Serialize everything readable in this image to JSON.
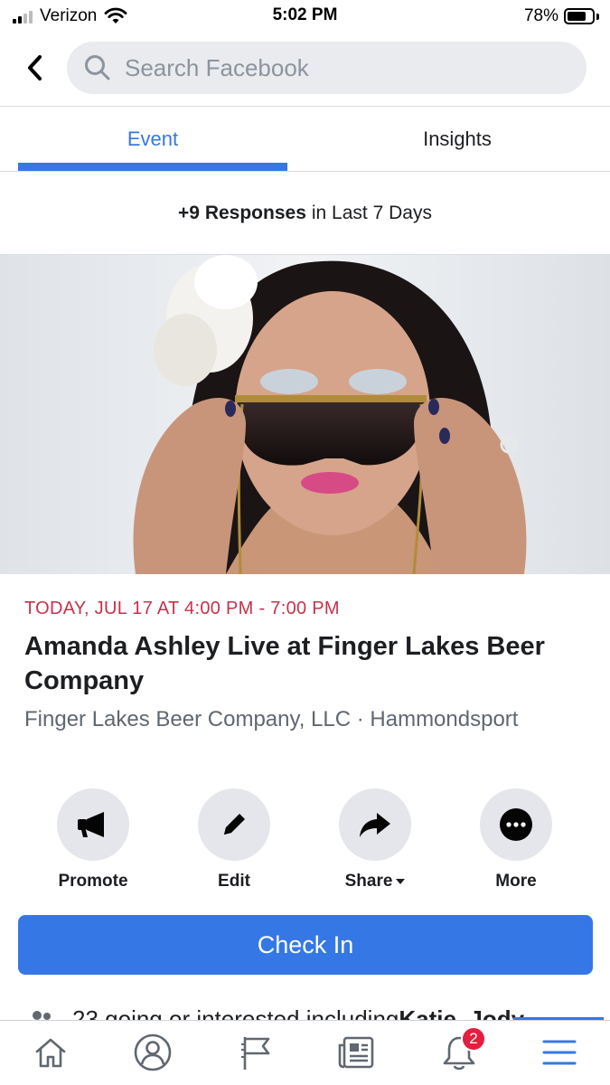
{
  "status_bar": {
    "carrier": "Verizon",
    "time": "5:02 PM",
    "battery": "78%",
    "battery_level": 0.78,
    "signal_bars": 4
  },
  "header": {
    "search_placeholder": "Search Facebook",
    "back_icon": "chevron-left-icon",
    "search_icon": "search-icon"
  },
  "tabs": [
    {
      "label": "Event",
      "active": true
    },
    {
      "label": "Insights",
      "active": false
    }
  ],
  "responses": {
    "count": "+9 Responses",
    "period": "in Last 7 Days"
  },
  "event": {
    "date": "TODAY, JUL 17 AT 4:00 PM - 7:00 PM",
    "title": "Amanda Ashley Live at Finger Lakes Beer Company",
    "host": "Finger Lakes Beer Company, LLC · Hammondsport"
  },
  "actions": [
    {
      "label": "Promote",
      "icon": "megaphone-icon"
    },
    {
      "label": "Edit",
      "icon": "pencil-icon"
    },
    {
      "label": "Share",
      "icon": "share-arrow-icon"
    },
    {
      "label": "More",
      "icon": "more-dots-icon"
    }
  ],
  "checkin": {
    "label": "Check In"
  },
  "going": {
    "text": "23 going or interested including ",
    "names": "Katie, Jody"
  },
  "bottom_nav": {
    "items": [
      "home-icon",
      "profile-icon",
      "pages-flag-icon",
      "news-icon",
      "notifications-bell-icon",
      "menu-icon"
    ],
    "notification_badge": "2"
  },
  "colors": {
    "accent": "#3578e5",
    "date_red": "#c8304a",
    "badge_red": "#e41e3f"
  }
}
